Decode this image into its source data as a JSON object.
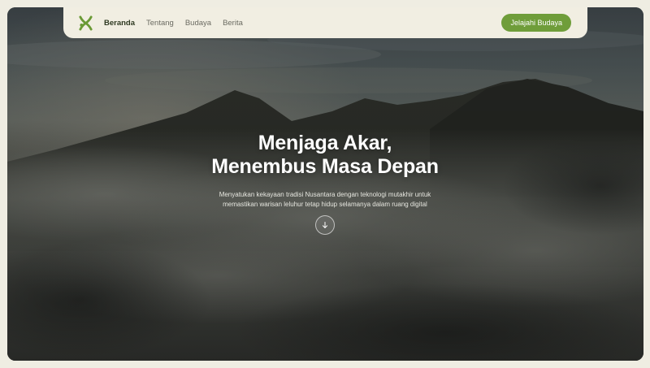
{
  "nav": {
    "links": [
      {
        "label": "Beranda",
        "active": true
      },
      {
        "label": "Tentang",
        "active": false
      },
      {
        "label": "Budaya",
        "active": false
      },
      {
        "label": "Berita",
        "active": false
      }
    ],
    "cta_label": "Jelajahi Budaya"
  },
  "hero": {
    "title_line1": "Menjaga Akar,",
    "title_line2": "Menembus Masa Depan",
    "subtitle_line1": "Menyatukan kekayaan tradisi Nusantara dengan teknologi mutakhir untuk",
    "subtitle_line2": "memastikan warisan leluhur tetap hidup selamanya dalam ruang digital",
    "scroll_icon": "arrow-down-icon"
  },
  "colors": {
    "page_background": "#efede2",
    "navbar_background": "#f1eee2",
    "accent_green": "#6f9d3a",
    "logo_green": "#6a9a35",
    "active_nav_text": "#2f3a22",
    "nav_text": "#6b6b62",
    "hero_text": "#ffffff"
  }
}
